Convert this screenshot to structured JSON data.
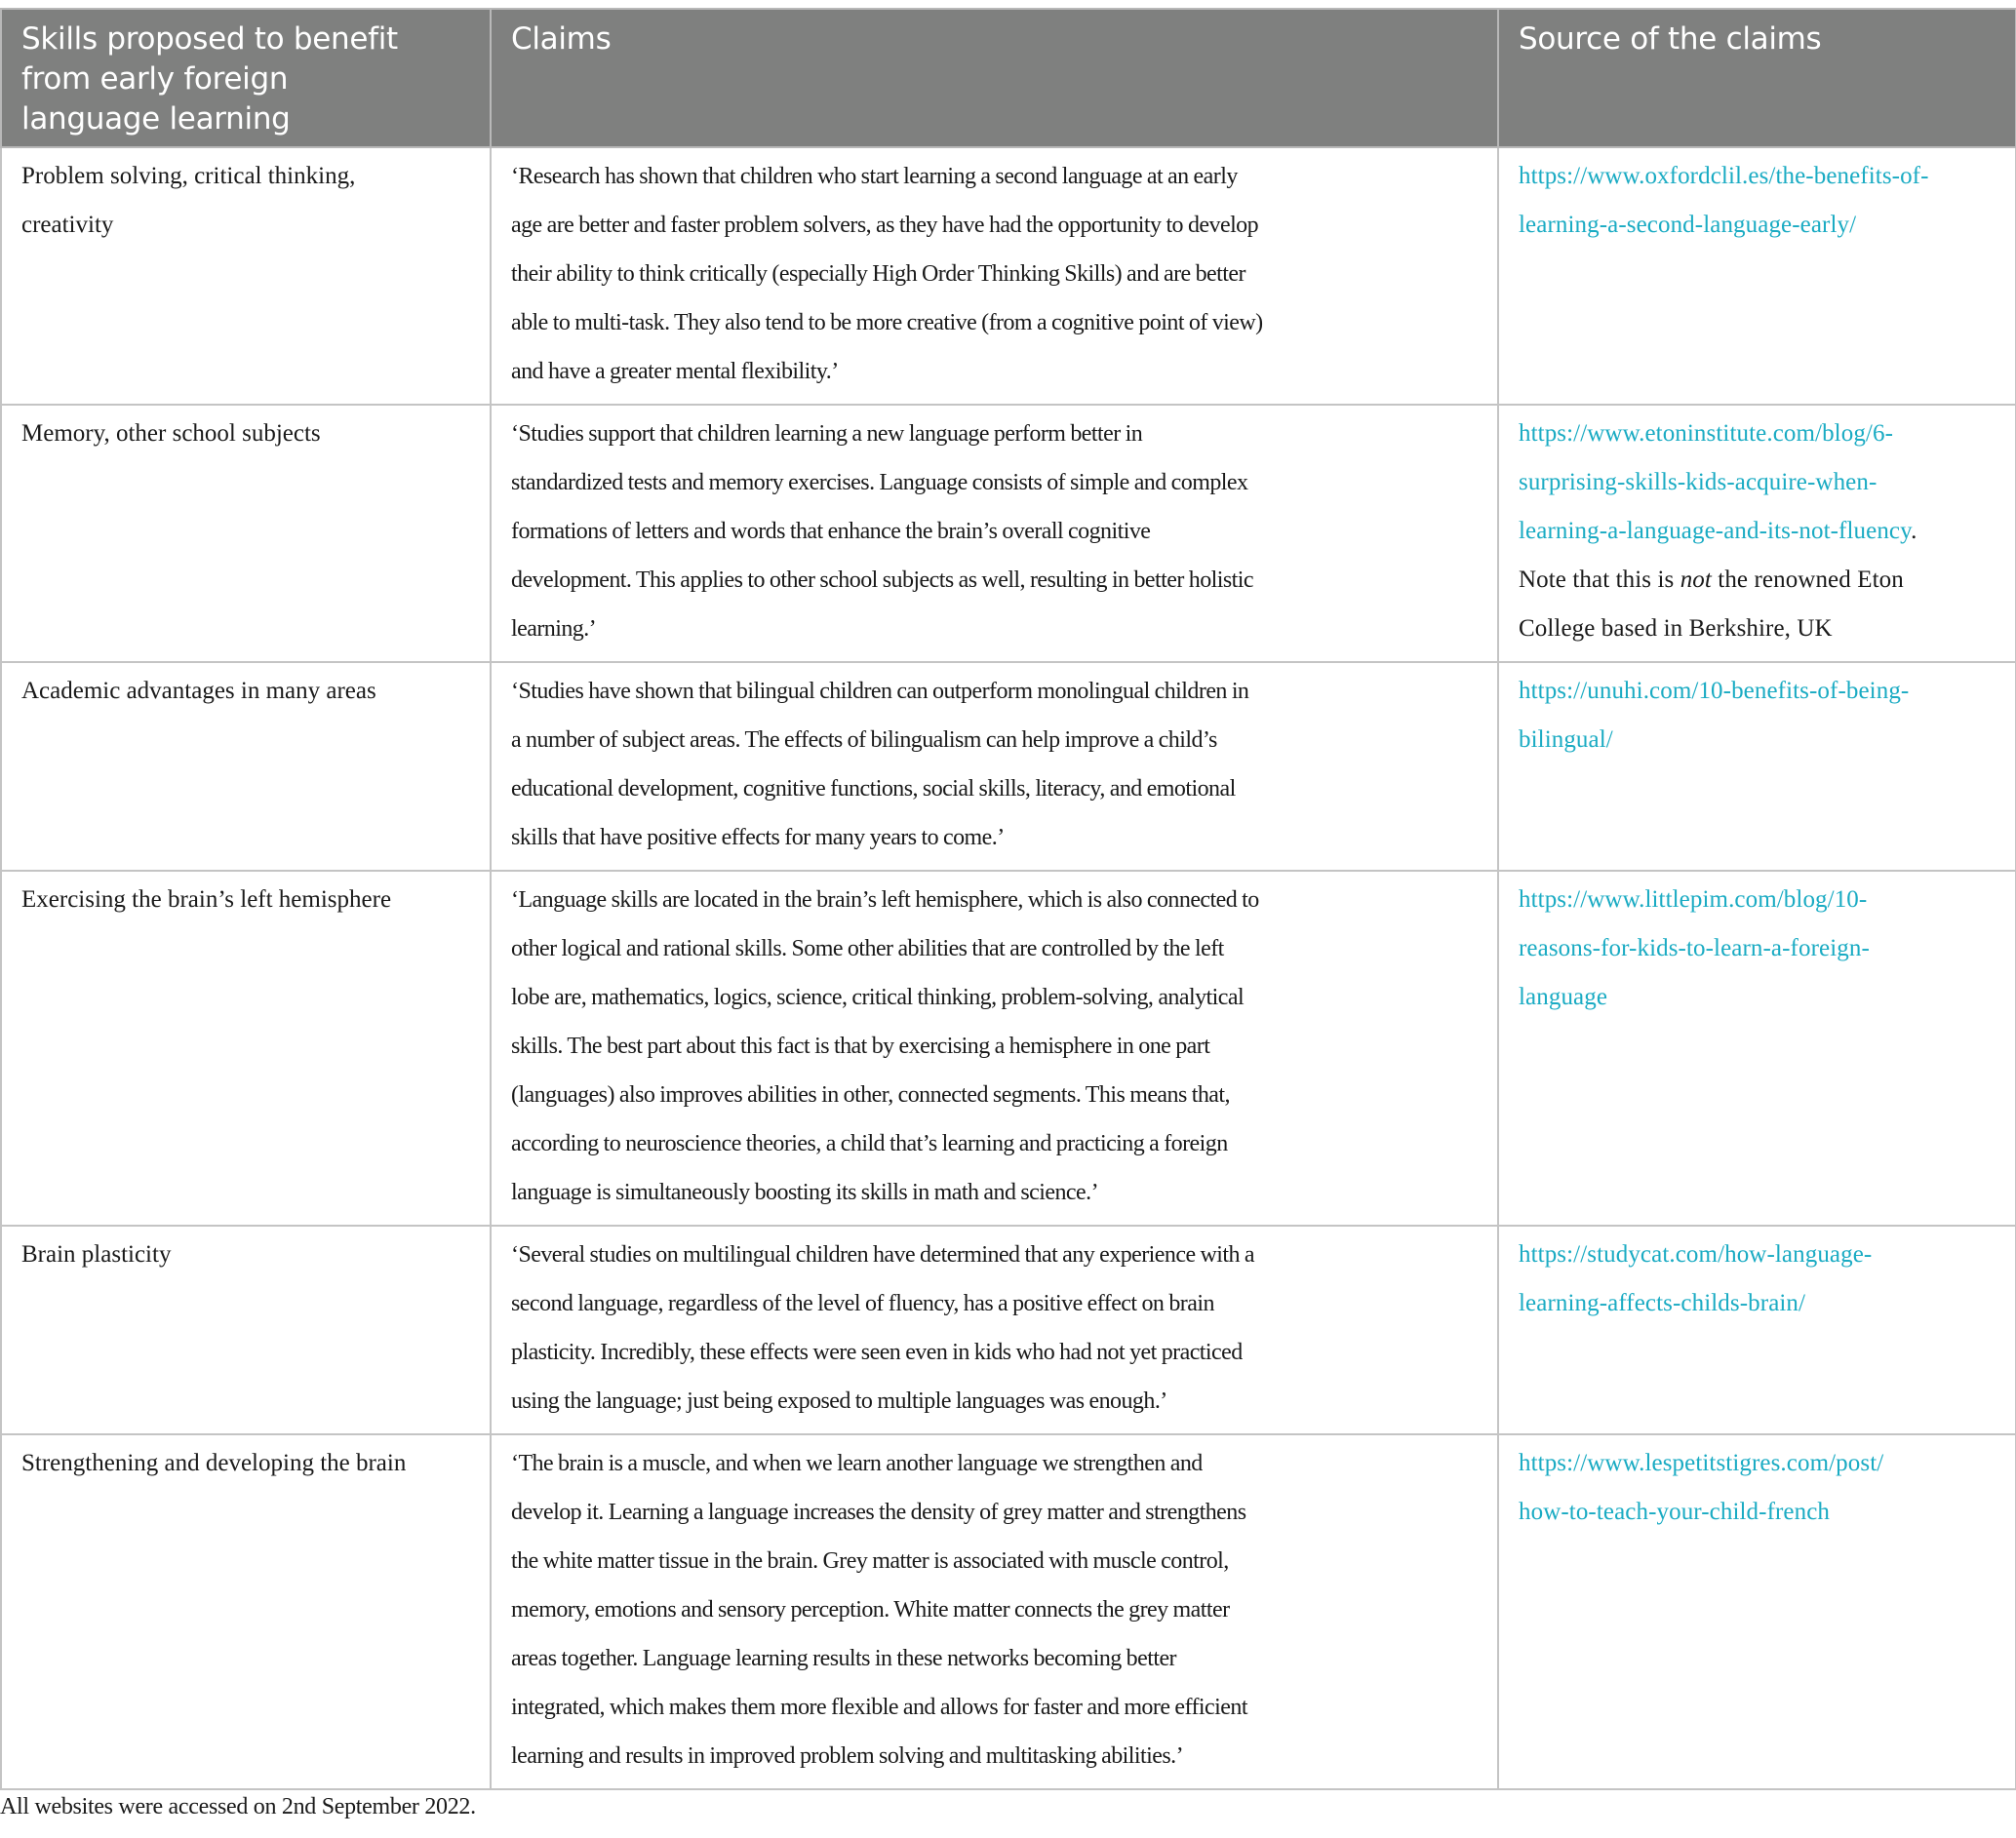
{
  "table": {
    "headers": [
      [
        "Skills proposed to benefit",
        "from early foreign",
        "language learning"
      ],
      [
        "Claims"
      ],
      [
        "Source of the claims"
      ]
    ],
    "rows": [
      {
        "skill": [
          "Problem solving, critical thinking,",
          "creativity"
        ],
        "claim": [
          "‘Research has shown that children who start learning a second language at an early",
          "age are better and faster problem solvers, as they have had the opportunity to develop",
          "their ability to think critically (especially High Order Thinking Skills) and are better",
          "able to multi-task. They also tend to be more creative (from a cognitive point of view)",
          "and have a greater mental flexibility.’"
        ],
        "source_link": [
          "https://www.oxfordclil.es/the-benefits-of-",
          "learning-a-second-language-early/"
        ],
        "source_note": []
      },
      {
        "skill": [
          "Memory, other school subjects"
        ],
        "claim": [
          "‘Studies support that children learning a new language perform better in",
          "standardized tests and memory exercises. Language consists of simple and complex",
          "formations of letters and words that enhance the brain’s overall cognitive",
          "development. This applies to other school subjects as well, resulting in better holistic",
          "learning.’"
        ],
        "source_link": [
          "https://www.etoninstitute.com/blog/6-",
          "surprising-skills-kids-acquire-when-",
          "learning-a-language-and-its-not-fluency"
        ],
        "source_link_suffix": ".",
        "source_note": [
          "Note that this is ",
          "not",
          " the renowned Eton",
          "College based in Berkshire, UK"
        ]
      },
      {
        "skill": [
          "Academic advantages in many areas"
        ],
        "claim": [
          "‘Studies have shown that bilingual children can outperform monolingual children in",
          "a number of subject areas. The effects of bilingualism can help improve a child’s",
          "educational development, cognitive functions, social skills, literacy, and emotional",
          "skills that have positive effects for many years to come.’"
        ],
        "source_link": [
          "https://unuhi.com/10-benefits-of-being-",
          "bilingual/"
        ],
        "source_note": []
      },
      {
        "skill": [
          "Exercising the brain’s left hemisphere"
        ],
        "claim": [
          "‘Language skills are located in the brain’s left hemisphere, which is also connected to",
          "other logical and rational skills. Some other abilities that are controlled by the left",
          "lobe are, mathematics, logics, science, critical thinking, problem-solving, analytical",
          "skills. The best part about this fact is that by exercising a hemisphere in one part",
          "(languages) also improves abilities in other, connected segments. This means that,",
          "according to neuroscience theories, a child that’s learning and practicing a foreign",
          "language is simultaneously boosting its skills in math and science.’"
        ],
        "source_link": [
          "https://www.littlepim.com/blog/10-",
          "reasons-for-kids-to-learn-a-foreign-",
          "language"
        ],
        "source_note": []
      },
      {
        "skill": [
          "Brain plasticity"
        ],
        "claim": [
          "‘Several studies on multilingual children have determined that any experience with a",
          "second language, regardless of the level of fluency, has a positive effect on brain",
          "plasticity. Incredibly, these effects were seen even in kids who had not yet practiced",
          "using the language; just being exposed to multiple languages was enough.’"
        ],
        "source_link": [
          "https://studycat.com/how-language-",
          "learning-affects-childs-brain/"
        ],
        "source_note": []
      },
      {
        "skill": [
          "Strengthening and developing the brain"
        ],
        "claim": [
          "‘The brain is a muscle, and when we learn another language we strengthen and",
          "develop it. Learning a language increases the density of grey matter and strengthens",
          "the white matter tissue in the brain. Grey matter is associated with muscle control,",
          "memory, emotions and sensory perception. White matter connects the grey matter",
          "areas together. Language learning results in these networks becoming better",
          "integrated, which makes them more flexible and allows for faster and more efficient",
          "learning and results in improved problem solving and multitasking abilities.’"
        ],
        "source_link": [
          "https://www.lespetitstigres.com/post/",
          "how-to-teach-your-child-french"
        ],
        "source_note": []
      }
    ]
  },
  "footnote": "All websites were accessed on 2nd September 2022.",
  "colors": {
    "header_bg": "#7f807f",
    "header_text": "#ffffff",
    "link": "#1aabc3",
    "body_text": "#1a1a1a",
    "grid": "#c4c4c4"
  }
}
